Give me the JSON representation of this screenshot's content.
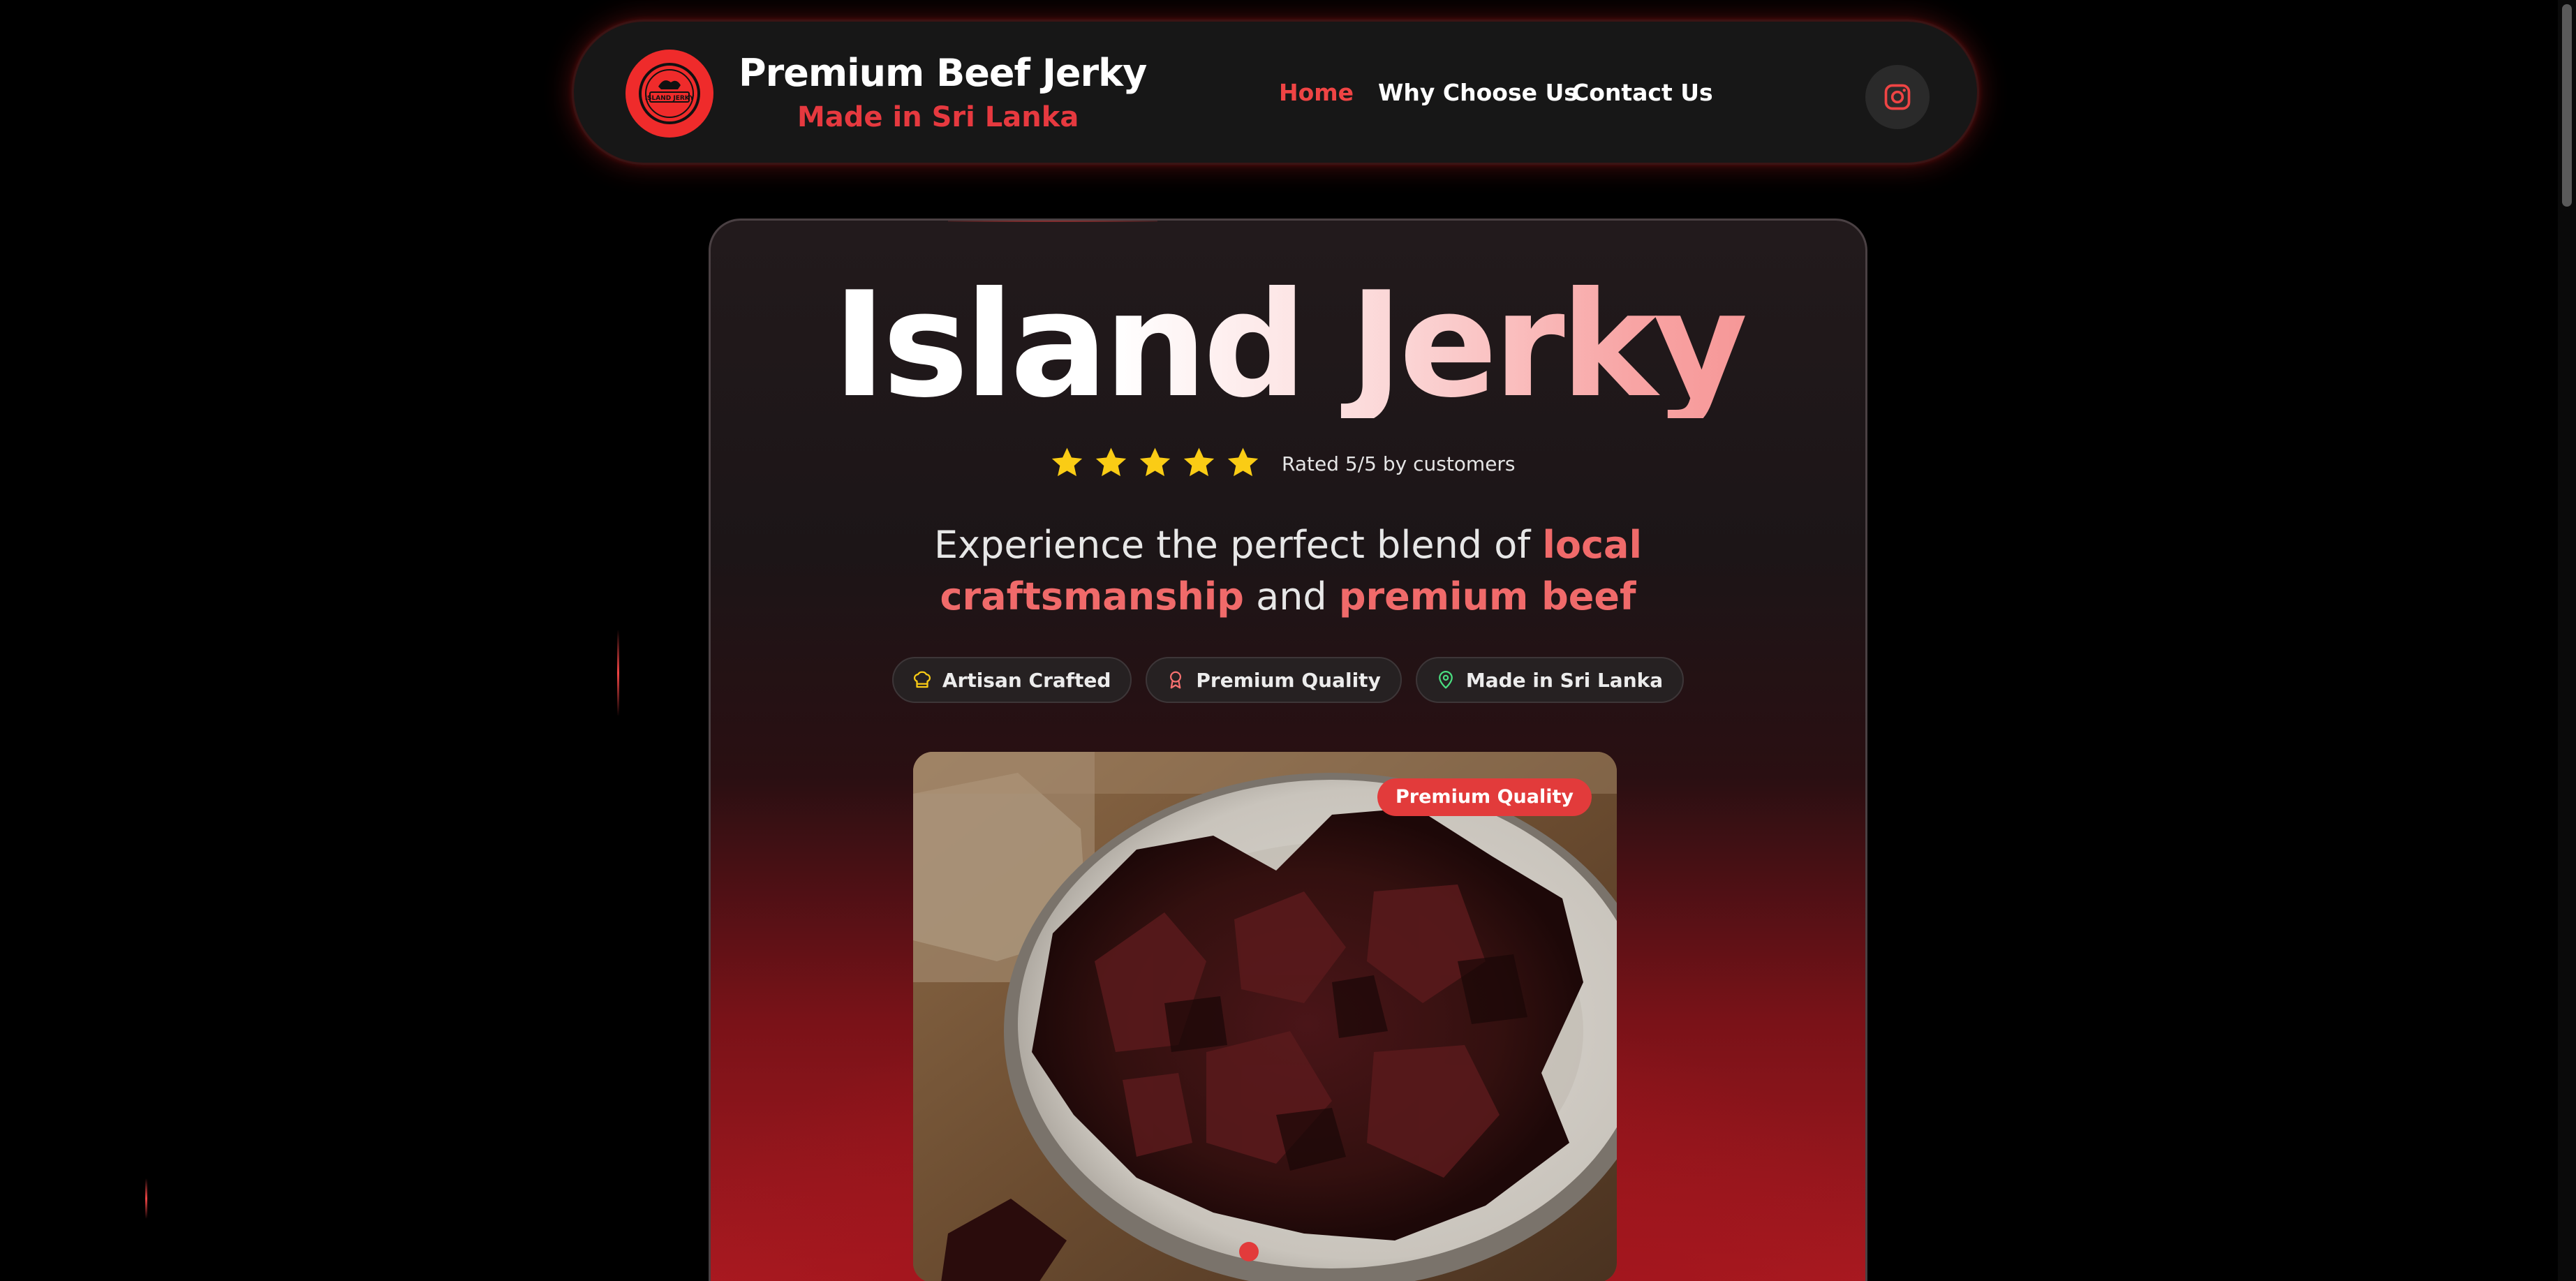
{
  "brand": {
    "title": "Premium Beef Jerky",
    "subtitle": "Made in Sri Lanka",
    "logo_text": "ISLAND JERKY",
    "logo_icon": "jerky-logo-icon",
    "accent_color": "#ef4444"
  },
  "nav": {
    "items": [
      {
        "label": "Home",
        "active": true
      },
      {
        "label": "Why Choose Us",
        "active": false
      },
      {
        "label": "Contact Us",
        "active": false
      }
    ],
    "social_icon": "instagram-icon"
  },
  "hero": {
    "title": "Island Jerky",
    "rating": {
      "stars": 5,
      "max": 5,
      "text": "Rated 5/5 by customers",
      "star_color": "#facc15"
    },
    "tagline": {
      "part1": "Experience the perfect blend of ",
      "highlight1": "local craftsmanship",
      "part2": " and ",
      "highlight2": "premium beef"
    },
    "badges": [
      {
        "label": "Artisan Crafted",
        "icon": "chef-hat-icon",
        "icon_color": "#facc15"
      },
      {
        "label": "Premium Quality",
        "icon": "award-ribbon-icon",
        "icon_color": "#f87171"
      },
      {
        "label": "Made in Sri Lanka",
        "icon": "map-pin-icon",
        "icon_color": "#4ade80"
      }
    ],
    "image": {
      "badge": "Premium Quality",
      "slides": 2,
      "active_slide": 1
    }
  }
}
